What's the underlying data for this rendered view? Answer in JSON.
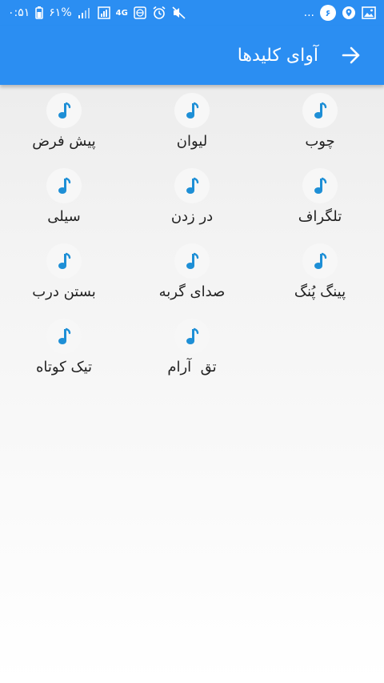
{
  "status_bar": {
    "time": "۰:۵۱",
    "battery": "۶۱%",
    "network": "4G",
    "notification_count": "۶",
    "more": "..."
  },
  "header": {
    "title": "آوای کلیدها",
    "back_icon": "arrow-right-icon"
  },
  "colors": {
    "primary": "#2b8ef2",
    "note_icon": "#1e8fd6"
  },
  "sounds": [
    {
      "label": "چوب",
      "icon": "music-note-icon"
    },
    {
      "label": "لیوان",
      "icon": "music-note-icon"
    },
    {
      "label": "پیش فرض",
      "icon": "music-note-icon"
    },
    {
      "label": "تلگراف",
      "icon": "music-note-icon"
    },
    {
      "label": "در زدن",
      "icon": "music-note-icon"
    },
    {
      "label": "سیلی",
      "icon": "music-note-icon"
    },
    {
      "label": "پینگ پُنگ",
      "icon": "music-note-icon"
    },
    {
      "label": "صدای گربه",
      "icon": "music-note-icon"
    },
    {
      "label": "بستن درب",
      "icon": "music-note-icon"
    },
    {
      "label": "تق  آرام",
      "icon": "music-note-icon"
    },
    {
      "label": "تیک کوتاه",
      "icon": "music-note-icon"
    }
  ]
}
